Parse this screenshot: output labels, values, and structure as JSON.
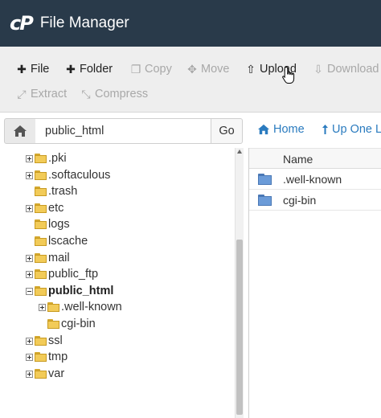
{
  "app": {
    "logo_text": "cP",
    "title": "File Manager",
    "header_color": "#293a4a"
  },
  "toolbar": {
    "row1": [
      {
        "id": "file",
        "label": "File",
        "icon": "plus-icon",
        "glyph": "✚",
        "enabled": true
      },
      {
        "id": "folder",
        "label": "Folder",
        "icon": "plus-icon",
        "glyph": "✚",
        "enabled": true
      },
      {
        "id": "copy",
        "label": "Copy",
        "icon": "copy-icon",
        "glyph": "❐",
        "enabled": false
      },
      {
        "id": "move",
        "label": "Move",
        "icon": "move-icon",
        "glyph": "✥",
        "enabled": false
      },
      {
        "id": "upload",
        "label": "Upload",
        "icon": "upload-icon",
        "glyph": "⇧",
        "enabled": true
      },
      {
        "id": "download",
        "label": "Download",
        "icon": "download-icon",
        "glyph": "⇩",
        "enabled": false
      }
    ],
    "row2": [
      {
        "id": "extract",
        "label": "Extract",
        "icon": "expand-icon",
        "glyph": "⤢",
        "enabled": false
      },
      {
        "id": "compress",
        "label": "Compress",
        "icon": "compress-icon",
        "glyph": "⤡",
        "enabled": false
      }
    ]
  },
  "pathbar": {
    "home_icon": "home-icon",
    "path_value": "public_html",
    "go_label": "Go",
    "home_link": "Home",
    "up_link": "Up One Le"
  },
  "tree": {
    "items": [
      {
        "name": ".pki",
        "expandable": true,
        "selected": false,
        "level": 0,
        "open": false
      },
      {
        "name": ".softaculous",
        "expandable": true,
        "selected": false,
        "level": 0,
        "open": false
      },
      {
        "name": ".trash",
        "expandable": false,
        "selected": false,
        "level": 0,
        "open": false
      },
      {
        "name": "etc",
        "expandable": true,
        "selected": false,
        "level": 0,
        "open": false
      },
      {
        "name": "logs",
        "expandable": false,
        "selected": false,
        "level": 0,
        "open": false
      },
      {
        "name": "lscache",
        "expandable": false,
        "selected": false,
        "level": 0,
        "open": false
      },
      {
        "name": "mail",
        "expandable": true,
        "selected": false,
        "level": 0,
        "open": false
      },
      {
        "name": "public_ftp",
        "expandable": true,
        "selected": false,
        "level": 0,
        "open": false
      },
      {
        "name": "public_html",
        "expandable": true,
        "selected": true,
        "level": 0,
        "open": true
      },
      {
        "name": ".well-known",
        "expandable": true,
        "selected": false,
        "level": 1,
        "open": false
      },
      {
        "name": "cgi-bin",
        "expandable": false,
        "selected": false,
        "level": 1,
        "open": false
      },
      {
        "name": "ssl",
        "expandable": true,
        "selected": false,
        "level": 0,
        "open": false
      },
      {
        "name": "tmp",
        "expandable": true,
        "selected": false,
        "level": 0,
        "open": false
      },
      {
        "name": "var",
        "expandable": true,
        "selected": false,
        "level": 0,
        "open": false
      }
    ]
  },
  "list": {
    "header_name": "Name",
    "rows": [
      {
        "name": ".well-known",
        "icon": "folder-icon"
      },
      {
        "name": "cgi-bin",
        "icon": "folder-icon"
      }
    ]
  },
  "colors": {
    "link": "#2a7bbf",
    "toolbar_bg": "#eeeeee",
    "disabled_text": "#a8a8a8"
  }
}
